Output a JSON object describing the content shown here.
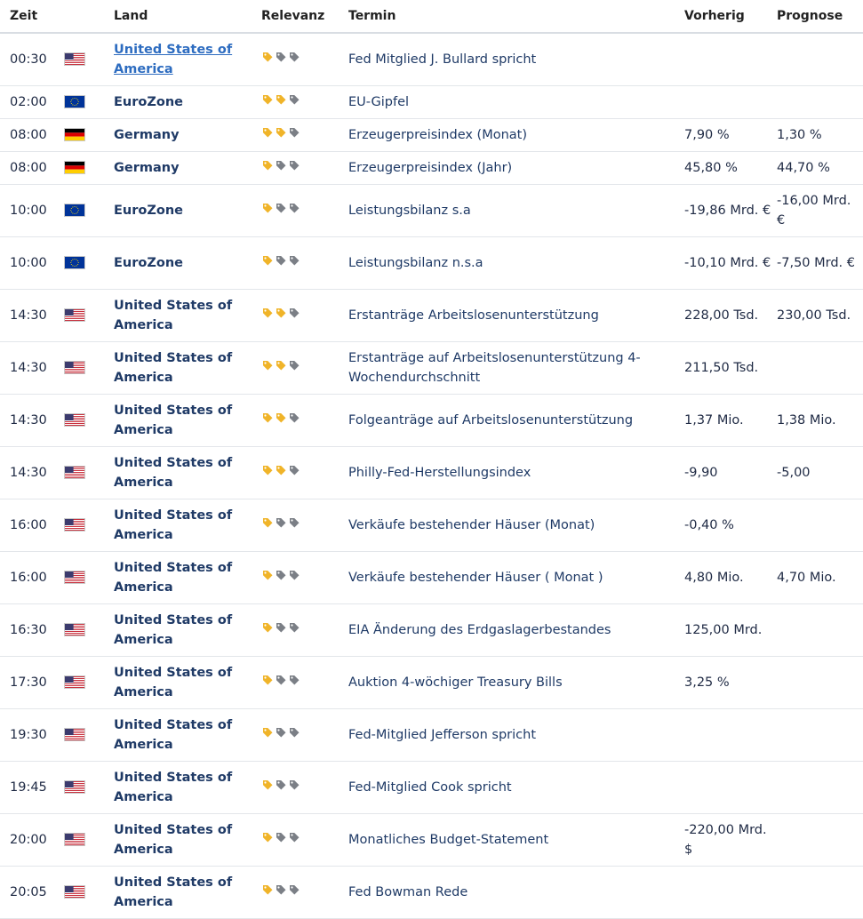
{
  "headers": {
    "zeit": "Zeit",
    "land": "Land",
    "relevanz": "Relevanz",
    "termin": "Termin",
    "vorherig": "Vorherig",
    "prognose": "Prognose"
  },
  "colors": {
    "tag_active": "#f0b429",
    "tag_inactive": "#7b7f86",
    "link": "#2d6cc0"
  },
  "rows": [
    {
      "zeit": "00:30",
      "flag": "us-flag-icon",
      "land": "United States of America",
      "land_link": true,
      "relevanz": 1,
      "termin": "Fed Mitglied J. Bullard spricht",
      "vorherig": "",
      "prognose": ""
    },
    {
      "zeit": "02:00",
      "flag": "eu-flag-icon",
      "land": "EuroZone",
      "relevanz": 2,
      "termin": "EU-Gipfel",
      "vorherig": "",
      "prognose": ""
    },
    {
      "zeit": "08:00",
      "flag": "de-flag-icon",
      "land": "Germany",
      "relevanz": 2,
      "termin": "Erzeugerpreisindex (Monat)",
      "vorherig": "7,90 %",
      "prognose": "1,30 %"
    },
    {
      "zeit": "08:00",
      "flag": "de-flag-icon",
      "land": "Germany",
      "relevanz": 1,
      "termin": "Erzeugerpreisindex (Jahr)",
      "vorherig": "45,80 %",
      "prognose": "44,70 %"
    },
    {
      "zeit": "10:00",
      "flag": "eu-flag-icon",
      "land": "EuroZone",
      "relevanz": 1,
      "termin": "Leistungsbilanz s.a",
      "vorherig": "-19,86 Mrd. €",
      "prognose": "-16,00 Mrd. €"
    },
    {
      "zeit": "10:00",
      "flag": "eu-flag-icon",
      "land": "EuroZone",
      "relevanz": 1,
      "termin": "Leistungsbilanz n.s.a",
      "vorherig": "-10,10 Mrd. €",
      "prognose": "-7,50 Mrd. €"
    },
    {
      "zeit": "14:30",
      "flag": "us-flag-icon",
      "land": "United States of America",
      "relevanz": 2,
      "termin": "Erstanträge Arbeitslosenunterstützung",
      "vorherig": "228,00 Tsd.",
      "prognose": "230,00 Tsd."
    },
    {
      "zeit": "14:30",
      "flag": "us-flag-icon",
      "land": "United States of America",
      "relevanz": 2,
      "termin": "Erstanträge auf Arbeitslosenunterstützung 4-Wochendurchschnitt",
      "vorherig": "211,50 Tsd.",
      "prognose": ""
    },
    {
      "zeit": "14:30",
      "flag": "us-flag-icon",
      "land": "United States of America",
      "relevanz": 2,
      "termin": "Folgeanträge auf Arbeitslosenunterstützung",
      "vorherig": "1,37 Mio.",
      "prognose": "1,38 Mio."
    },
    {
      "zeit": "14:30",
      "flag": "us-flag-icon",
      "land": "United States of America",
      "relevanz": 2,
      "termin": "Philly-Fed-Herstellungsindex",
      "vorherig": "-9,90",
      "prognose": "-5,00"
    },
    {
      "zeit": "16:00",
      "flag": "us-flag-icon",
      "land": "United States of America",
      "relevanz": 1,
      "termin": "Verkäufe bestehender Häuser (Monat)",
      "vorherig": "-0,40 %",
      "prognose": ""
    },
    {
      "zeit": "16:00",
      "flag": "us-flag-icon",
      "land": "United States of America",
      "relevanz": 1,
      "termin": "Verkäufe bestehender Häuser ( Monat )",
      "vorherig": "4,80 Mio.",
      "prognose": "4,70 Mio."
    },
    {
      "zeit": "16:30",
      "flag": "us-flag-icon",
      "land": "United States of America",
      "relevanz": 1,
      "termin": "EIA Änderung des Erdgaslagerbestandes",
      "vorherig": "125,00 Mrd.",
      "prognose": ""
    },
    {
      "zeit": "17:30",
      "flag": "us-flag-icon",
      "land": "United States of America",
      "relevanz": 1,
      "termin": "Auktion 4-wöchiger Treasury Bills",
      "vorherig": "3,25 %",
      "prognose": ""
    },
    {
      "zeit": "19:30",
      "flag": "us-flag-icon",
      "land": "United States of America",
      "relevanz": 1,
      "termin": "Fed-Mitglied Jefferson spricht",
      "vorherig": "",
      "prognose": ""
    },
    {
      "zeit": "19:45",
      "flag": "us-flag-icon",
      "land": "United States of America",
      "relevanz": 1,
      "termin": "Fed-Mitglied Cook spricht",
      "vorherig": "",
      "prognose": ""
    },
    {
      "zeit": "20:00",
      "flag": "us-flag-icon",
      "land": "United States of America",
      "relevanz": 1,
      "termin": "Monatliches Budget-Statement",
      "vorherig": "-220,00 Mrd. $",
      "prognose": ""
    },
    {
      "zeit": "20:05",
      "flag": "us-flag-icon",
      "land": "United States of America",
      "relevanz": 1,
      "termin": "Fed Bowman Rede",
      "vorherig": "",
      "prognose": ""
    }
  ]
}
